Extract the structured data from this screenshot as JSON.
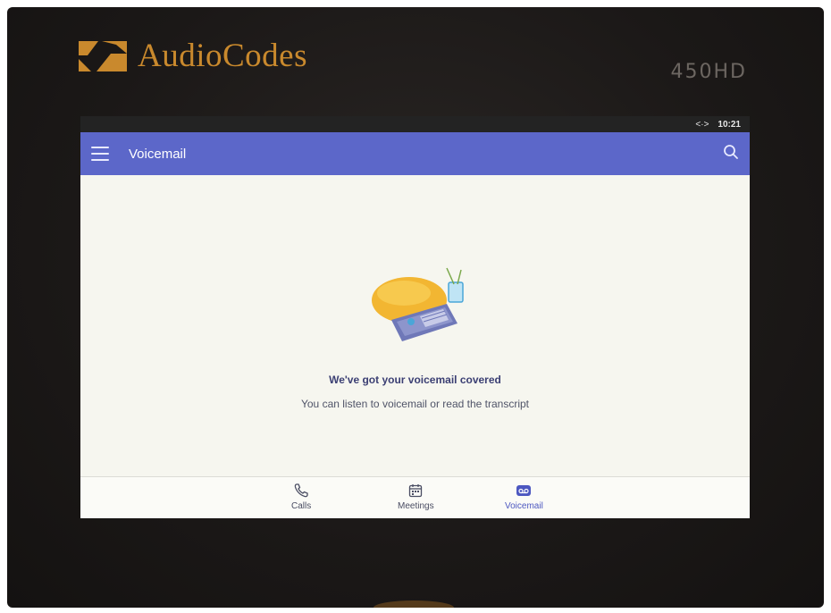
{
  "device": {
    "brand": "AudioCodes",
    "model": "450HD"
  },
  "status_bar": {
    "arrows": "<·>",
    "time": "10:21"
  },
  "app_bar": {
    "title": "Voicemail"
  },
  "empty_state": {
    "headline": "We've got your voicemail covered",
    "subtext": "You can listen to voicemail or read the transcript"
  },
  "nav": {
    "items": [
      {
        "label": "Calls",
        "icon": "phone-icon"
      },
      {
        "label": "Meetings",
        "icon": "calendar-icon"
      },
      {
        "label": "Voicemail",
        "icon": "voicemail-icon",
        "active": true
      }
    ]
  },
  "colors": {
    "accent": "#5c67c9",
    "brand": "#c9892d"
  }
}
